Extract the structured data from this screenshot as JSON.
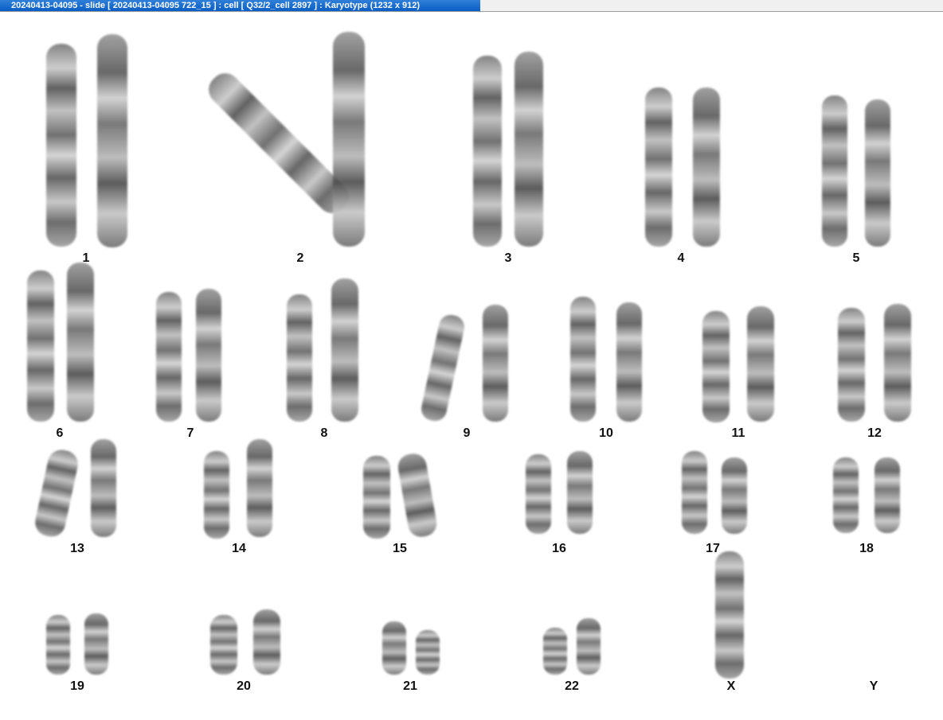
{
  "window": {
    "title": "20240413-04095 - slide [ 20240413-04095 722_15 ] : cell [ Q32/2_cell 2897 ] : Karyotype  (1232 x 912)"
  },
  "karyotype": {
    "labels": {
      "c1": "1",
      "c2": "2",
      "c3": "3",
      "c4": "4",
      "c5": "5",
      "c6": "6",
      "c7": "7",
      "c8": "8",
      "c9": "9",
      "c10": "10",
      "c11": "11",
      "c12": "12",
      "c13": "13",
      "c14": "14",
      "c15": "15",
      "c16": "16",
      "c17": "17",
      "c18": "18",
      "c19": "19",
      "c20": "20",
      "c21": "21",
      "c22": "22",
      "cX": "X",
      "cY": "Y"
    }
  }
}
